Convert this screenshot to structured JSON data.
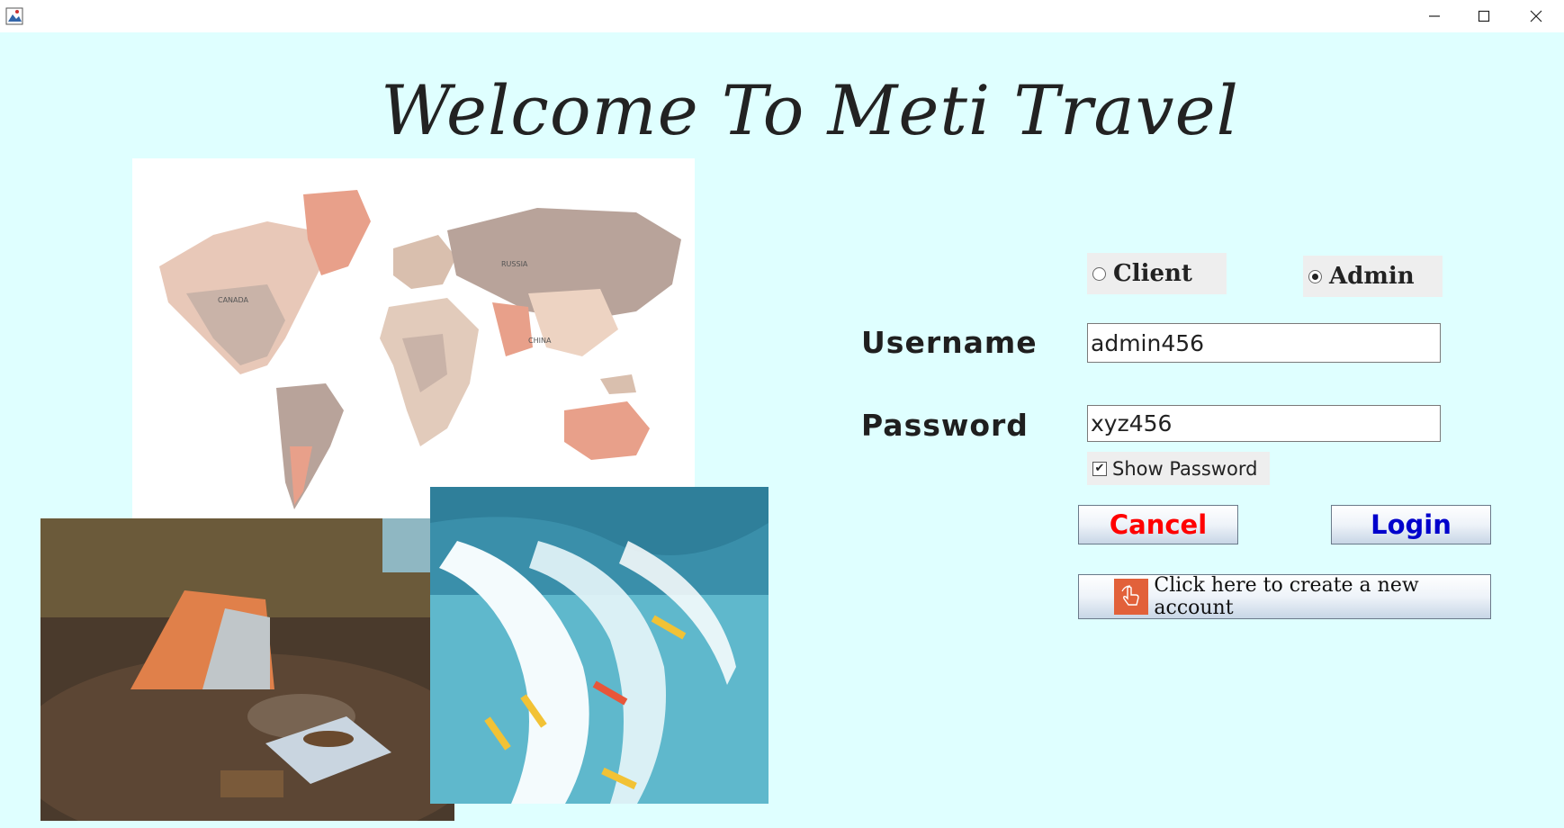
{
  "window": {
    "title": ""
  },
  "header": {
    "title": "Welcome To Meti Travel"
  },
  "role": {
    "options": [
      {
        "label": "Client",
        "selected": false
      },
      {
        "label": "Admin",
        "selected": true
      }
    ]
  },
  "form": {
    "username_label": "Username",
    "username_value": "admin456",
    "password_label": "Password",
    "password_value": "xyz456",
    "show_password_label": "Show Password",
    "show_password_checked": true
  },
  "buttons": {
    "cancel_label": "Cancel",
    "login_label": "Login",
    "create_account_label": "Click here to create a new account"
  },
  "colors": {
    "background": "#dfffff",
    "cancel_text": "#ff0000",
    "login_text": "#0000cc",
    "create_icon_bg": "#e2613a"
  },
  "icons": {
    "minimize": "minimize-icon",
    "maximize": "maximize-icon",
    "close": "close-icon",
    "create_account": "hand-pointer-icon"
  },
  "images": {
    "map": "world-map-image",
    "camp": "camping-photo",
    "surf": "surfing-photo"
  }
}
